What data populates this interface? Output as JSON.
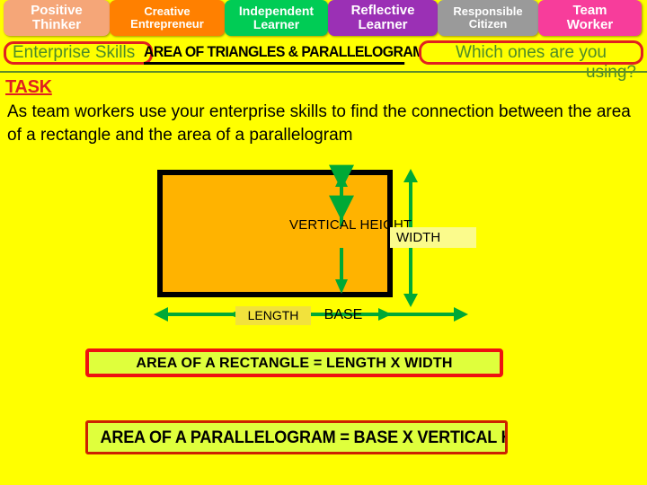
{
  "skills_banner": {
    "chips": [
      {
        "name": "positive-thinker",
        "line1": "Positive",
        "line2": "Thinker",
        "color": "#F5A678"
      },
      {
        "name": "creative-entrepreneur",
        "line1": "Creative",
        "line2": "Entrepreneur",
        "color": "#FF8000"
      },
      {
        "name": "independent-learner",
        "line1": "Independent",
        "line2": "Learner",
        "color": "#00CC55"
      },
      {
        "name": "reflective-learner",
        "line1": "Reflective",
        "line2": "Learner",
        "color": "#9B30B5"
      },
      {
        "name": "responsible-citizen",
        "line1": "Responsible",
        "line2": "Citizen",
        "color": "#9A9A9A"
      },
      {
        "name": "team-worker",
        "line1": "Team",
        "line2": "Worker",
        "color": "#F73D9B"
      }
    ]
  },
  "header": {
    "enterprise_skills_label": "Enterprise Skills",
    "title": "AREA OF TRIANGLES & PARALLELOGRAMS",
    "question_line1": "Which ones are you",
    "question_line2": "using?"
  },
  "task": {
    "label": "TASK",
    "body": "As team workers use your enterprise skills to find the connection between the area of a rectangle and the area of a parallelogram"
  },
  "diagram": {
    "shape_fill": "#FFB300",
    "shape_stroke": "#000000",
    "arrow_color": "#00A936",
    "labels": {
      "vertical_height": "VERTICAL HEIGHT",
      "width": "WIDTH",
      "length": "LENGTH",
      "base": "BASE"
    }
  },
  "formulas": {
    "rectangle": "AREA OF A RECTANGLE  = LENGTH X WIDTH",
    "parallelogram": "AREA OF A PARALLELOGRAM = BASE X VERTICAL HEIGHT"
  },
  "colors": {
    "page_background": "#FFFF00",
    "accent_red": "#E02020",
    "accent_green_text": "#4E8B28",
    "formula_background": "#DFFF3C"
  }
}
